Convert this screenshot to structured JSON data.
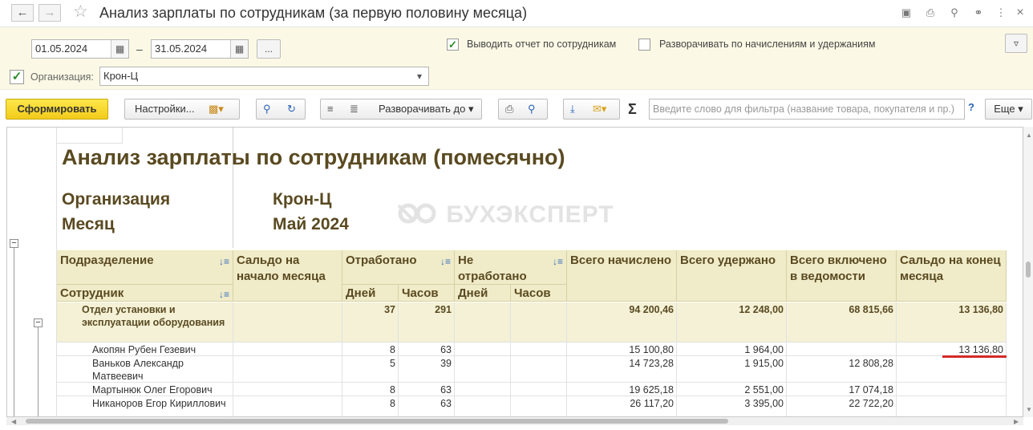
{
  "window": {
    "title": "Анализ зарплаты по сотрудникам (за первую половину месяца)"
  },
  "params": {
    "date_from": "01.05.2024",
    "date_separator": "–",
    "date_to": "31.05.2024",
    "period_button": "...",
    "show_by_employee_label": "Выводить отчет по сотрудникам",
    "show_by_employee_checked": true,
    "expand_accruals_label": "Разворачивать по начислениям и удержаниям",
    "expand_accruals_checked": false,
    "org_checked": true,
    "org_label": "Организация:",
    "org_value": "Крон-Ц"
  },
  "toolbar": {
    "generate": "Сформировать",
    "settings": "Настройки...",
    "expand_to": "Разворачивать до",
    "filter_placeholder": "Введите слово для фильтра (название товара, покупателя и пр.)",
    "help": "?",
    "more": "Еще"
  },
  "report": {
    "title": "Анализ зарплаты по сотрудникам (помесячно)",
    "org_label": "Организация",
    "org_value": "Крон-Ц",
    "month_label": "Месяц",
    "month_value": "Май 2024",
    "watermark": "БУХЭКСПЕРТ",
    "columns": {
      "department": "Подразделение",
      "employee": "Сотрудник",
      "opening_balance": "Сальдо на начало месяца",
      "worked": "Отработано",
      "not_worked": "Не отработано",
      "days": "Дней",
      "hours": "Часов",
      "accrued": "Всего начислено",
      "withheld": "Всего удержано",
      "in_statement": "Всего включено в ведомости",
      "closing_balance": "Сальдо на конец месяца"
    },
    "group": {
      "name": "Отдел установки и эксплуатации оборудования",
      "days": "37",
      "hours": "291",
      "accrued": "94 200,46",
      "withheld": "12 248,00",
      "in_statement": "68 815,66",
      "closing": "13 136,80"
    },
    "rows": [
      {
        "name": "Акопян Рубен Гезевич",
        "days": "8",
        "hours": "63",
        "accrued": "15 100,80",
        "withheld": "1 964,00",
        "in_statement": "",
        "closing": "13 136,80"
      },
      {
        "name": "Ваньков Александр Матвеевич",
        "days": "5",
        "hours": "39",
        "accrued": "14 723,28",
        "withheld": "1 915,00",
        "in_statement": "12 808,28",
        "closing": ""
      },
      {
        "name": "Мартынюк Олег Егорович",
        "days": "8",
        "hours": "63",
        "accrued": "19 625,18",
        "withheld": "2 551,00",
        "in_statement": "17 074,18",
        "closing": ""
      },
      {
        "name": "Никаноров Егор Кириллович",
        "days": "8",
        "hours": "63",
        "accrued": "26 117,20",
        "withheld": "3 395,00",
        "in_statement": "22 722,20",
        "closing": ""
      }
    ]
  },
  "colors": {
    "accent_yellow": "#f2cb1a",
    "header_bg": "#f0ebc8",
    "title_brown": "#5a4a21",
    "highlight_red": "#d42a2a"
  }
}
